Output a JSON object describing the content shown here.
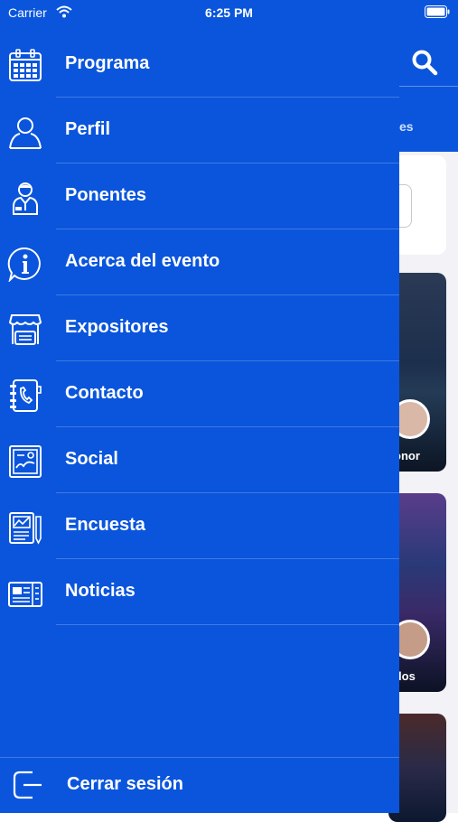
{
  "status_bar": {
    "carrier": "Carrier",
    "time": "6:25 PM"
  },
  "background": {
    "tab_fragment": "es",
    "event_cards": [
      {
        "name_fragment": "onor"
      },
      {
        "name_fragment": "rlos"
      }
    ]
  },
  "drawer": {
    "items": [
      {
        "label": "Programa",
        "icon": "calendar-icon"
      },
      {
        "label": "Perfil",
        "icon": "user-icon"
      },
      {
        "label": "Ponentes",
        "icon": "speaker-icon"
      },
      {
        "label": "Acerca del evento",
        "icon": "info-icon"
      },
      {
        "label": "Expositores",
        "icon": "booth-icon"
      },
      {
        "label": "Contacto",
        "icon": "phonebook-icon"
      },
      {
        "label": "Social",
        "icon": "social-icon"
      },
      {
        "label": "Encuesta",
        "icon": "survey-icon"
      },
      {
        "label": "Noticias",
        "icon": "news-icon"
      }
    ],
    "logout_label": "Cerrar sesión"
  },
  "colors": {
    "primary": "#0a55dc",
    "text": "#ffffff"
  }
}
